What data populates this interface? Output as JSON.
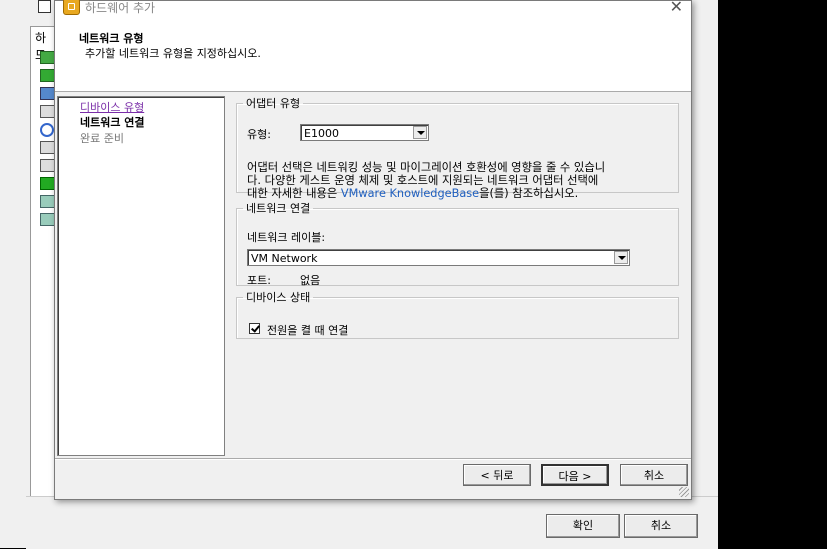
{
  "parent": {
    "side_title": "하드",
    "ok_label": "확인",
    "cancel_label": "취소"
  },
  "dialog": {
    "title": "하드웨어 추가",
    "header_title": "네트워크 유형",
    "header_subtitle": "추가할 네트워크 유형을 지정하십시오."
  },
  "steps": [
    {
      "label": "디바이스 유형",
      "state": "visited"
    },
    {
      "label": "네트워크 연결",
      "state": "current"
    },
    {
      "label": "완료 준비",
      "state": "future"
    }
  ],
  "adapter": {
    "legend": "어댑터 유형",
    "type_label": "유형:",
    "type_value": "E1000",
    "desc_line1": "어댑터 선택은 네트워킹 성능 및 마이그레이션 호환성에 영향을 줄 수 있습니",
    "desc_line2": "다. 다양한 게스트 운영 체제 및 호스트에 지원되는 네트워크 어댑터 선택에",
    "desc_line3_pre": "대한 자세한 내용은 ",
    "desc_link": "VMware KnowledgeBase",
    "desc_line3_post": "을(를) 참조하십시오."
  },
  "network": {
    "legend": "네트워크 연결",
    "label_label": "네트워크 레이블:",
    "label_value": "VM Network",
    "port_label": "포트:",
    "port_value": "없음"
  },
  "device_status": {
    "legend": "디바이스 상태",
    "connect_on_power_label": "전원을 켤 때 연결",
    "connect_on_power_checked": true
  },
  "buttons": {
    "back": "< 뒤로",
    "next": "다음 >",
    "cancel": "취소"
  }
}
